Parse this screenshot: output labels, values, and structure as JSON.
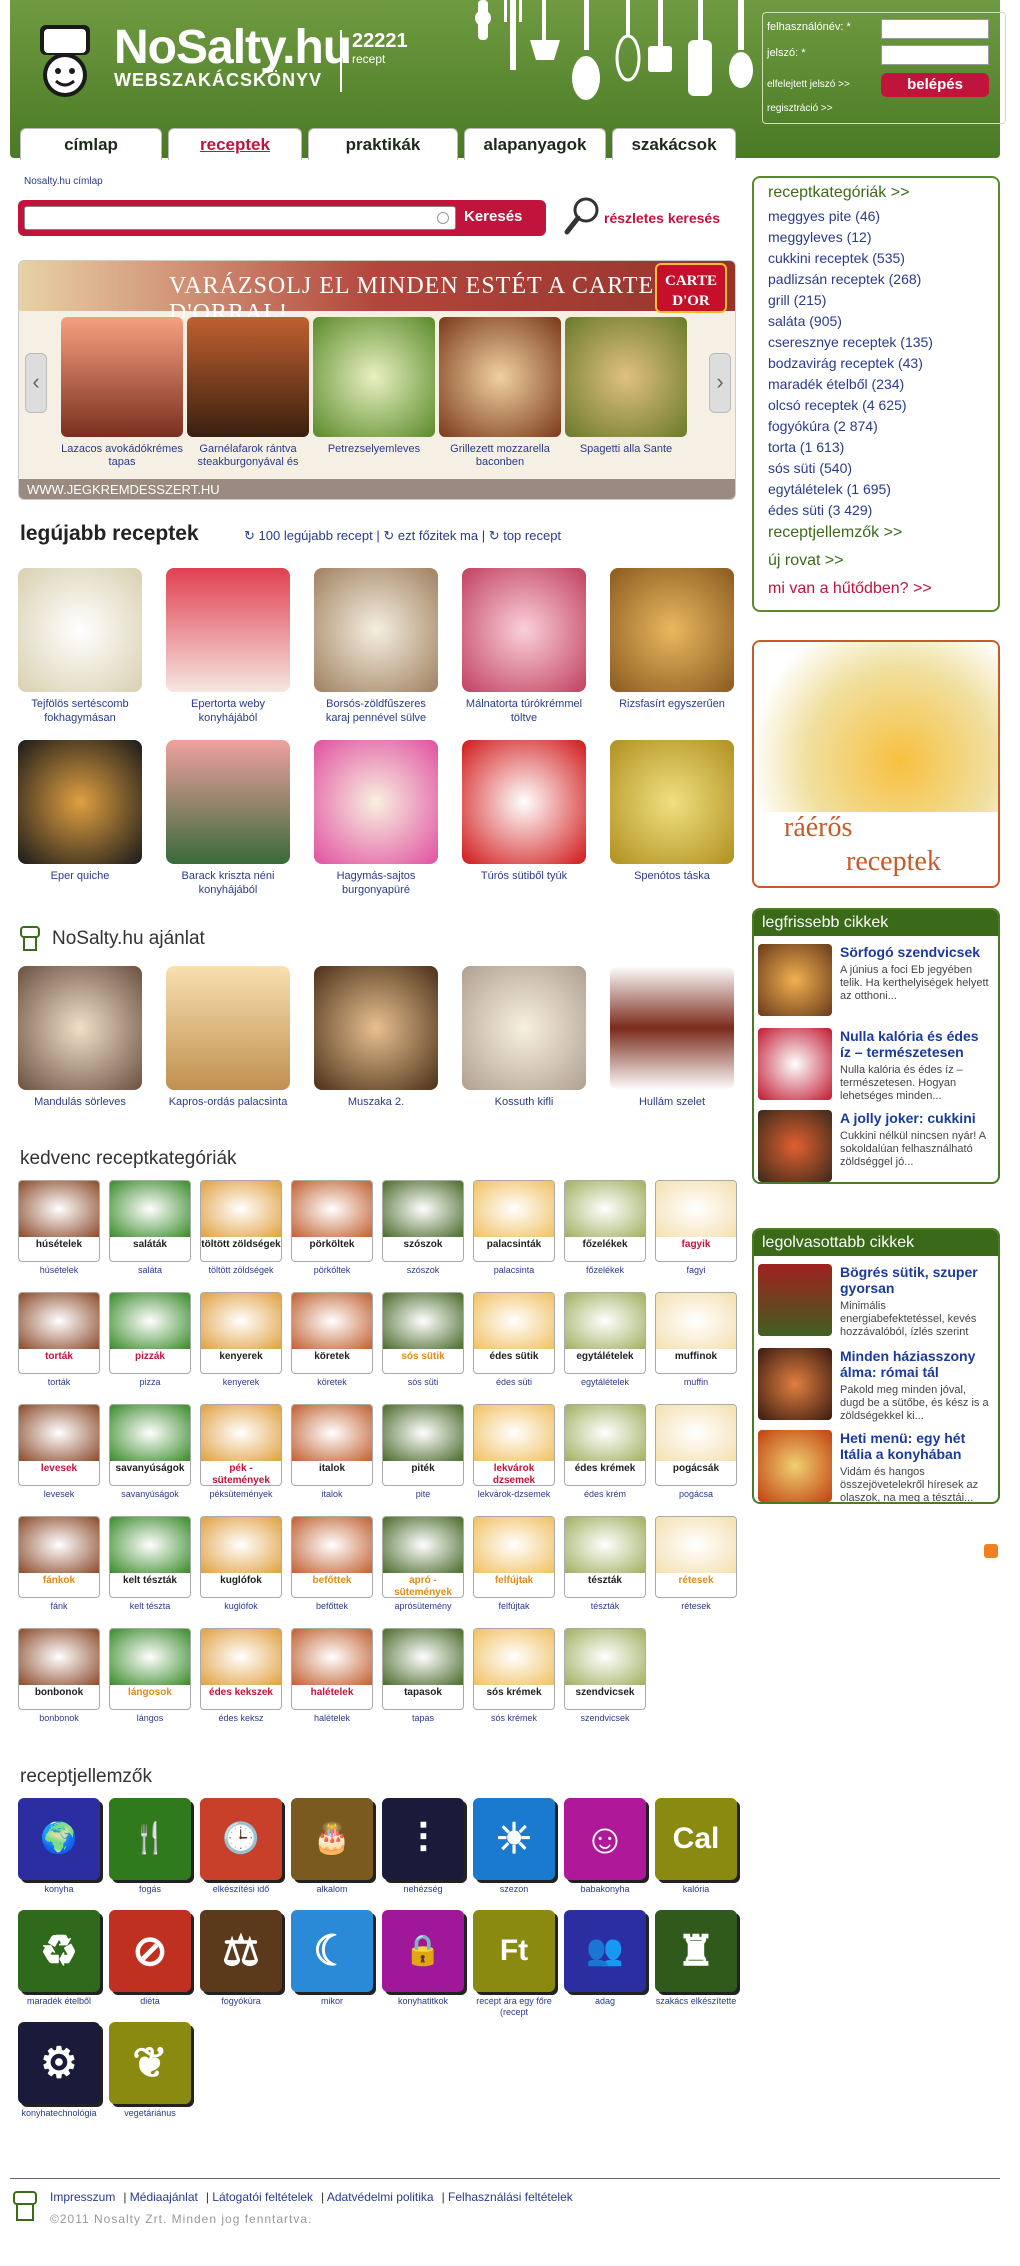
{
  "header": {
    "site_name": "NoSalty.hu",
    "site_subtitle": "WEBSZAKÁCSKÖNYV",
    "recipe_count": "22221",
    "recipe_count_label": "recept"
  },
  "login": {
    "username_label": "felhasználónév: *",
    "password_label": "jelszó: *",
    "forgot_password": "elfelejtett jelszó >>",
    "login_button": "belépés",
    "register": "regisztráció >>"
  },
  "tabs": [
    "címlap",
    "receptek",
    "praktikák",
    "alapanyagok",
    "szakácsok"
  ],
  "breadcrumb": "Nosalty.hu címlap",
  "search": {
    "button": "Keresés",
    "advanced": "részletes keresés"
  },
  "banner": {
    "title": "VARÁZSOLJ EL MINDEN ESTÉT A CARTE D'ORRAL!",
    "brand": "CARTE D'OR",
    "url": "WWW.JEGKREMDESSZERT.HU",
    "slides": [
      "Lazacos avokádókrémes tapas",
      "Garnélafarok rántva steakburgonyával és",
      "Petrezselyemleves",
      "Grillezett mozzarella baconben",
      "Spagetti alla Sante"
    ]
  },
  "latest": {
    "title": "legújabb receptek",
    "links": [
      "100 legújabb recept",
      "ezt főzitek ma",
      "top recept"
    ],
    "items": [
      "Tejfölös sertéscomb fokhagymásan",
      "Epertorta weby konyhájából",
      "Borsós-zöldfűszeres karaj pennével sülve",
      "Málnatorta túrókrémmel töltve",
      "Rizsfasírt egyszerűen",
      "Eper quiche",
      "Barack kriszta néni konyhájából",
      "Hagymás-sajtos burgonyapüré",
      "Túrós sütiből tyúk",
      "Spenótos táska"
    ]
  },
  "recommend": {
    "title": "NoSalty.hu ajánlat",
    "items": [
      "Mandulás sörleves",
      "Kapros-ordás palacsinta",
      "Muszaka 2.",
      "Kossuth kifli",
      "Hullám szelet"
    ]
  },
  "fav_categories": {
    "title": "kedvenc receptkategóriák",
    "items": [
      {
        "label": "húsételek",
        "cap": "húsételek",
        "color": "#222222"
      },
      {
        "label": "saláták",
        "cap": "saláta",
        "color": "#222222"
      },
      {
        "label": "töltött zöldségek",
        "cap": "töltött zöldségek",
        "color": "#222222"
      },
      {
        "label": "pörköltek",
        "cap": "pörköltek",
        "color": "#222222"
      },
      {
        "label": "szószok",
        "cap": "szószok",
        "color": "#222222"
      },
      {
        "label": "palacsinták",
        "cap": "palacsinta",
        "color": "#222222"
      },
      {
        "label": "főzelékek",
        "cap": "főzelékek",
        "color": "#222222"
      },
      {
        "label": "fagyik",
        "cap": "fagyi",
        "color": "#c0143c"
      },
      {
        "label": "torták",
        "cap": "torták",
        "color": "#c0143c"
      },
      {
        "label": "pizzák",
        "cap": "pizza",
        "color": "#c0143c"
      },
      {
        "label": "kenyerek",
        "cap": "kenyerek",
        "color": "#222222"
      },
      {
        "label": "köretek",
        "cap": "köretek",
        "color": "#222222"
      },
      {
        "label": "sós sütik",
        "cap": "sós süti",
        "color": "#e08a1a"
      },
      {
        "label": "édes sütik",
        "cap": "édes süti",
        "color": "#222222"
      },
      {
        "label": "egytálételek",
        "cap": "egytálételek",
        "color": "#222222"
      },
      {
        "label": "muffinok",
        "cap": "muffin",
        "color": "#222222"
      },
      {
        "label": "levesek",
        "cap": "levesek",
        "color": "#c0143c"
      },
      {
        "label": "savanyúságok",
        "cap": "savanyúságok",
        "color": "#222222"
      },
      {
        "label": "pék - sütemények",
        "cap": "péksütemények",
        "color": "#c0143c"
      },
      {
        "label": "italok",
        "cap": "italok",
        "color": "#222222"
      },
      {
        "label": "piték",
        "cap": "pite",
        "color": "#222222"
      },
      {
        "label": "lekvárok dzsemek",
        "cap": "lekvárok-dzsemek",
        "color": "#c0143c"
      },
      {
        "label": "édes krémek",
        "cap": "édes krém",
        "color": "#222222"
      },
      {
        "label": "pogácsák",
        "cap": "pogácsa",
        "color": "#222222"
      },
      {
        "label": "fánkok",
        "cap": "fánk",
        "color": "#e08a1a"
      },
      {
        "label": "kelt tészták",
        "cap": "kelt tészta",
        "color": "#222222"
      },
      {
        "label": "kuglófok",
        "cap": "kuglófok",
        "color": "#222222"
      },
      {
        "label": "befőttek",
        "cap": "befőttek",
        "color": "#e08a1a"
      },
      {
        "label": "apró - sütemények",
        "cap": "aprósütemény",
        "color": "#e08a1a"
      },
      {
        "label": "felfújtak",
        "cap": "felfújtak",
        "color": "#e08a1a"
      },
      {
        "label": "tészták",
        "cap": "tészták",
        "color": "#222222"
      },
      {
        "label": "rétesek",
        "cap": "rétesek",
        "color": "#e08a1a"
      },
      {
        "label": "bonbonok",
        "cap": "bonbonok",
        "color": "#222222"
      },
      {
        "label": "lángosok",
        "cap": "lángos",
        "color": "#e08a1a"
      },
      {
        "label": "édes kekszek",
        "cap": "édes keksz",
        "color": "#c0143c"
      },
      {
        "label": "halételek",
        "cap": "halételek",
        "color": "#c0143c"
      },
      {
        "label": "tapasok",
        "cap": "tapas",
        "color": "#222222"
      },
      {
        "label": "sós krémek",
        "cap": "sós krémek",
        "color": "#222222"
      },
      {
        "label": "szendvicsek",
        "cap": "szendvicsek",
        "color": "#222222"
      }
    ]
  },
  "features": {
    "title": "receptjellemzők",
    "items": [
      {
        "cap": "konyha",
        "icon": "globe-icon",
        "glyph": "🌍",
        "color": "#2b2ea0"
      },
      {
        "cap": "fogás",
        "icon": "cutlery-icon",
        "glyph": "🍴",
        "color": "#2f7a1c"
      },
      {
        "cap": "elkészítési idő",
        "icon": "clock-icon",
        "glyph": "🕒",
        "color": "#c8402a"
      },
      {
        "cap": "alkalom",
        "icon": "cake-icon",
        "glyph": "🎂",
        "color": "#7a5a1e"
      },
      {
        "cap": "nehézség",
        "icon": "spoons-icon",
        "glyph": "⫶",
        "color": "#1a1a3a"
      },
      {
        "cap": "szezon",
        "icon": "sun-snow-icon",
        "glyph": "☀",
        "color": "#1a7ad0"
      },
      {
        "cap": "babakonyha",
        "icon": "baby-icon",
        "glyph": "☺",
        "color": "#b0189a"
      },
      {
        "cap": "kalória",
        "icon": "cal-icon",
        "glyph": "Cal",
        "color": "#8a8a10"
      },
      {
        "cap": "maradék ételből",
        "icon": "recycle-icon",
        "glyph": "♻",
        "color": "#2f6a1c"
      },
      {
        "cap": "diéta",
        "icon": "no-icon",
        "glyph": "⊘",
        "color": "#c03020"
      },
      {
        "cap": "fogyókúra",
        "icon": "weight-icon",
        "glyph": "⚖",
        "color": "#5a3a1a"
      },
      {
        "cap": "mikor",
        "icon": "sun-moon-icon",
        "glyph": "☾",
        "color": "#2a8ad8"
      },
      {
        "cap": "konyhatitkok",
        "icon": "lock-icon",
        "glyph": "🔒",
        "color": "#a0189a"
      },
      {
        "cap": "recept ára egy főre (recept",
        "icon": "price-icon",
        "glyph": "Ft",
        "color": "#8a8a10"
      },
      {
        "cap": "adag",
        "icon": "people-icon",
        "glyph": "👥",
        "color": "#2b2ea0"
      },
      {
        "cap": "szakács elkészítette",
        "icon": "chef-icon",
        "glyph": "♜",
        "color": "#2f5a1c"
      },
      {
        "cap": "konyhatechnológia",
        "icon": "gears-icon",
        "glyph": "⚙",
        "color": "#1a1a3a"
      },
      {
        "cap": "vegetáriánus",
        "icon": "leaf-icon",
        "glyph": "❦",
        "color": "#8a8a10"
      }
    ]
  },
  "sidebar": {
    "categories_head": "receptkategóriák >>",
    "categories": [
      "meggyes pite (46)",
      "meggyleves (12)",
      "cukkini receptek (535)",
      "padlizsán receptek (268)",
      "grill (215)",
      "saláta (905)",
      "cseresznye receptek (135)",
      "bodzavirág receptek (43)",
      "maradék ételből (234)",
      "olcsó receptek (4 625)",
      "fogyókúra (2 874)",
      "torta (1 613)",
      "sós süti (540)",
      "egytálételek (1 695)",
      "édes süti (3 429)"
    ],
    "features_link": "receptjellemzők >>",
    "new_section": "új rovat >>",
    "fridge": "mi van a hűtődben? >>",
    "promo_text": [
      "ráérős",
      "receptek"
    ],
    "latest_articles_title": "legfrissebb cikkek",
    "latest_articles": [
      {
        "title": "Sörfogó szendvicsek",
        "desc": "A június a foci Eb jegyében telik. Ha kerthelyiségek helyett az otthoni..."
      },
      {
        "title": "Nulla kalória és édes íz – természetesen",
        "desc": "Nulla kalória és édes íz – természetesen. Hogyan lehetséges minden..."
      },
      {
        "title": "A jolly joker: cukkini",
        "desc": "Cukkini nélkül nincsen nyár! A sokoldalúan felhasználható zöldséggel jó..."
      }
    ],
    "most_read_title": "legolvasottabb cikkek",
    "most_read": [
      {
        "title": "Bögrés sütik, szuper gyorsan",
        "desc": "Minimális energiabefektetéssel, kevés hozzávalóból, ízlés szerint"
      },
      {
        "title": "Minden háziasszony álma: római tál",
        "desc": "Pakold meg minden jóval, dugd be a sütőbe, és kész is a zöldségekkel ki..."
      },
      {
        "title": "Heti menü: egy hét Itália a konyhában",
        "desc": "Vidám és hangos összejövetelekről híresek az olaszok, na meg a tésztái..."
      }
    ]
  },
  "footer": {
    "links": [
      "Impresszum",
      "Médiaajánlat",
      "Látogatói feltételek",
      "Adatvédelmi politika",
      "Felhasználási feltételek"
    ],
    "copyright": "©2011 Nosalty Zrt. Minden jog fenntartva."
  }
}
